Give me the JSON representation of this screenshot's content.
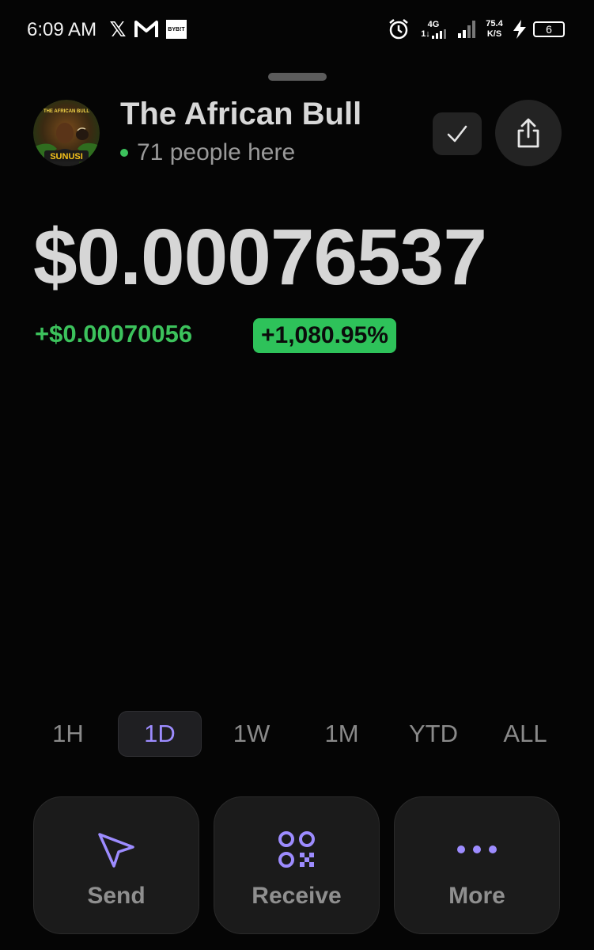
{
  "status_bar": {
    "time": "6:09 AM",
    "app_icons": [
      "x-logo-icon",
      "m-logo-icon",
      "bybit-icon"
    ],
    "bybit_label": "BYB!T",
    "network": "4G",
    "network_sub": "1↓",
    "speed_value": "75.4",
    "speed_unit": "K/S",
    "battery": "6"
  },
  "header": {
    "title": "The African Bull",
    "presence": "71 people here",
    "avatar_text_top": "THE AFRICAN BULL",
    "avatar_text_bottom": "SUNUSI"
  },
  "price": {
    "value": "$0.00076537",
    "change": "+$0.00070056",
    "change_percent": "+1,080.95%"
  },
  "range_tabs": {
    "items": [
      "1H",
      "1D",
      "1W",
      "1M",
      "YTD",
      "ALL"
    ],
    "active": "1D"
  },
  "actions": {
    "send": "Send",
    "receive": "Receive",
    "more": "More"
  },
  "colors": {
    "accent": "#9d8cff",
    "positive": "#3cc25c",
    "background": "#050505"
  }
}
